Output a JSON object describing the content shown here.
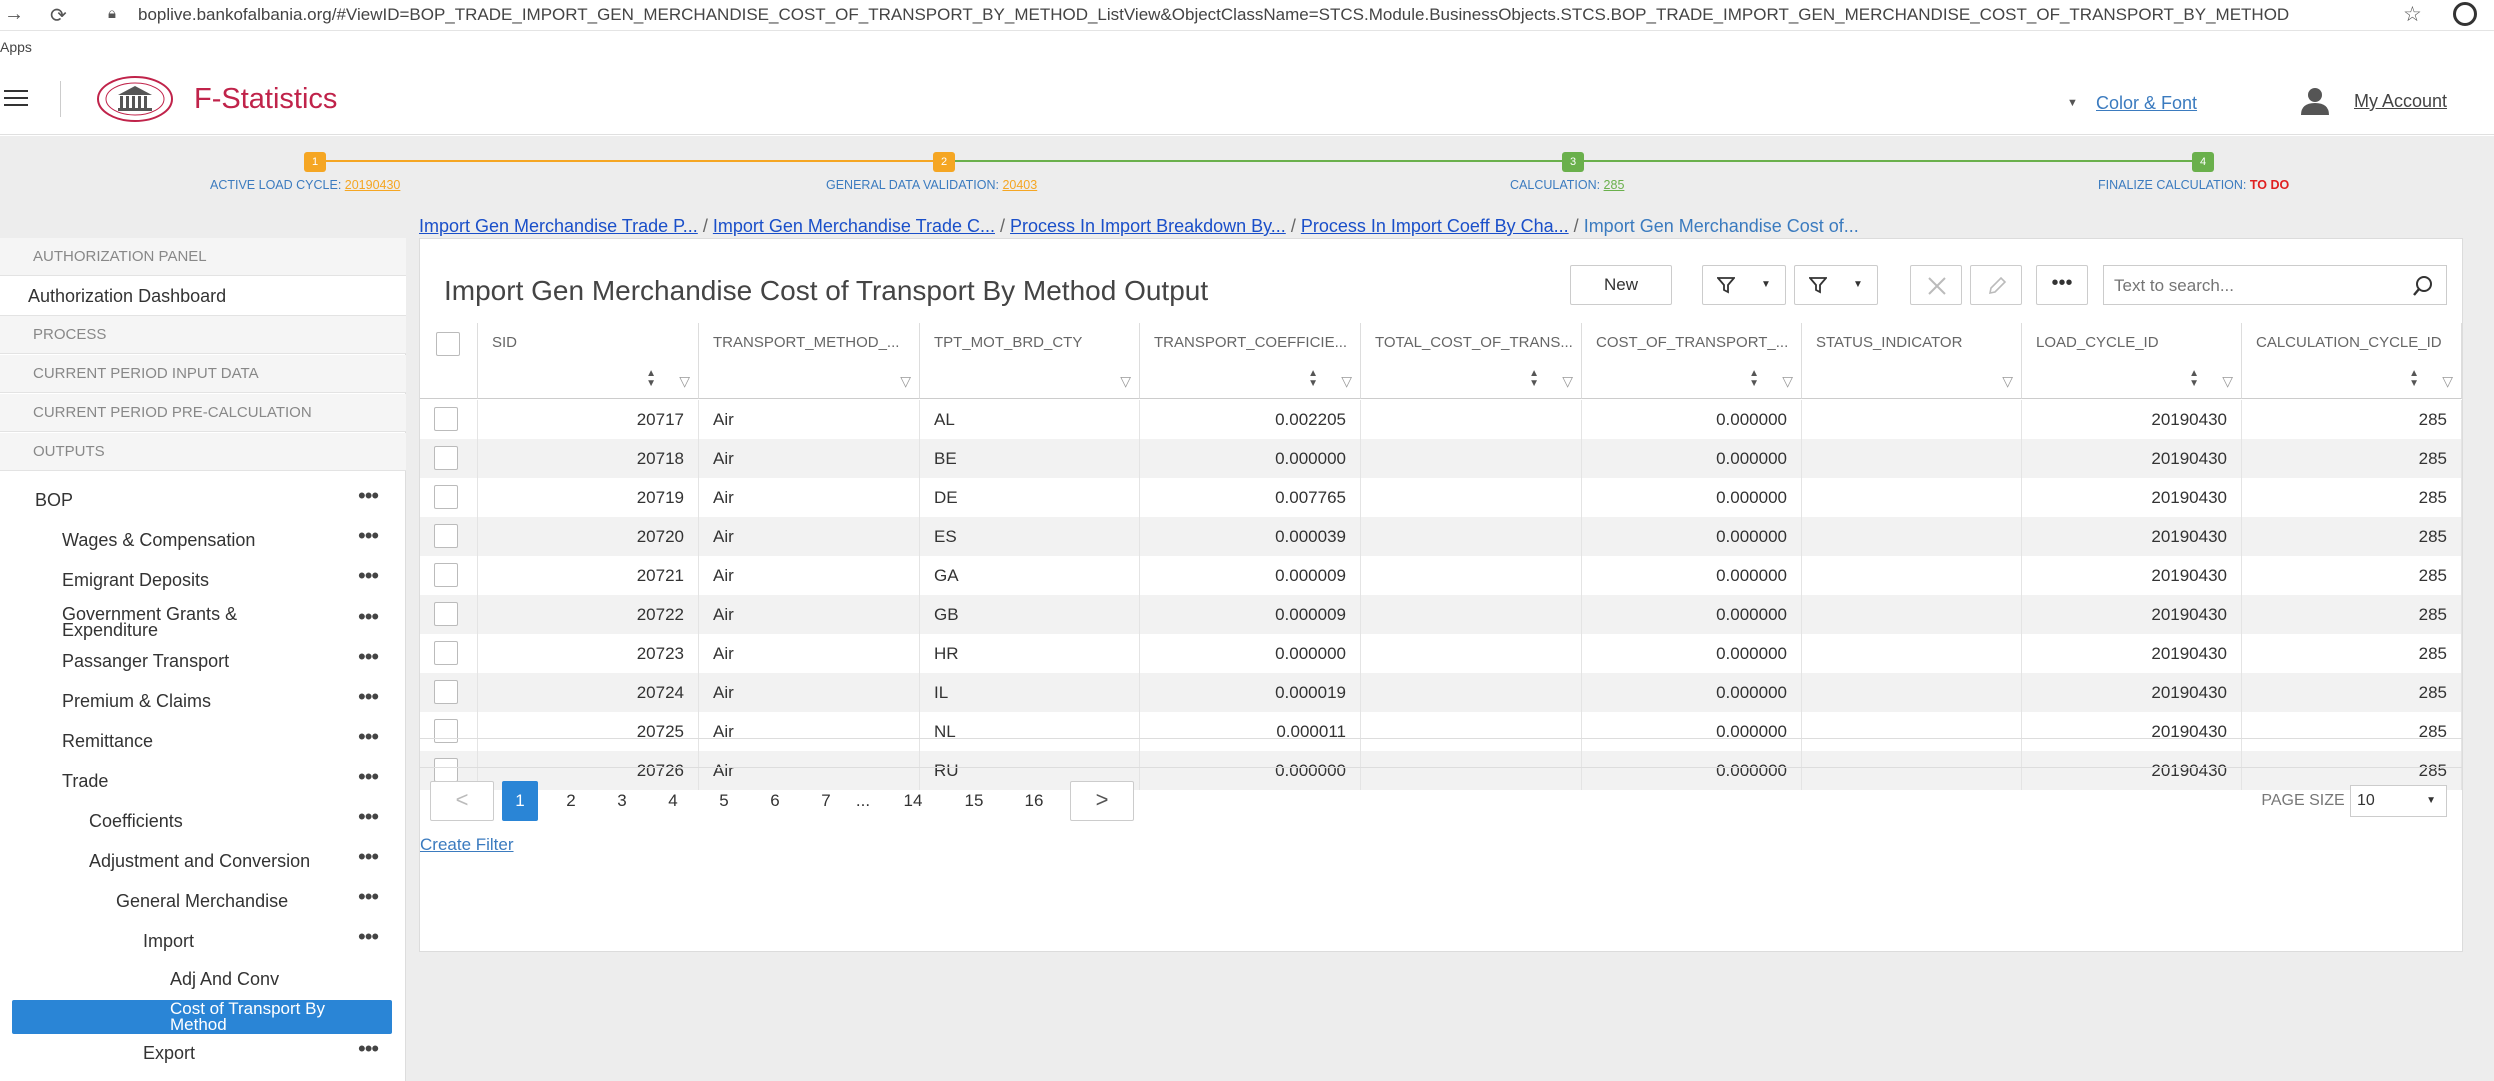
{
  "browser": {
    "url": "boplive.bankofalbania.org/#ViewID=BOP_TRADE_IMPORT_GEN_MERCHANDISE_COST_OF_TRANSPORT_BY_METHOD_ListView&ObjectClassName=STCS.Module.BusinessObjects.STCS.BOP_TRADE_IMPORT_GEN_MERCHANDISE_COST_OF_TRANSPORT_BY_METHOD",
    "apps_label": "Apps"
  },
  "header": {
    "brand": "F-Statistics",
    "color_font": "Color & Font",
    "my_account": "My Account",
    "logo_lettering": "BANK OF ALBANIA"
  },
  "progress": {
    "steps": [
      {
        "num": "1",
        "label": "ACTIVE LOAD CYCLE: ",
        "value": "20190430",
        "color": "#f5a623",
        "value_color": "#f5a623"
      },
      {
        "num": "2",
        "label": "GENERAL DATA VALIDATION: ",
        "value": "20403",
        "color": "#f5a623",
        "value_color": "#f5a623"
      },
      {
        "num": "3",
        "label": "CALCULATION: ",
        "value": "285",
        "color": "#6ab04c",
        "value_color": "#6ab04c"
      },
      {
        "num": "4",
        "label": "FINALIZE CALCULATION: ",
        "value": "TO DO",
        "color": "#6ab04c",
        "value_color": "#e02020"
      }
    ]
  },
  "sidebar": {
    "authorization_panel": "AUTHORIZATION PANEL",
    "authorization_dashboard": "Authorization Dashboard",
    "process": "PROCESS",
    "current_input": "CURRENT PERIOD INPUT DATA",
    "current_precalc": "CURRENT PERIOD PRE-CALCULATION",
    "outputs": "OUTPUTS",
    "tree": {
      "bop": "BOP",
      "wages": "Wages & Compensation",
      "emigrant": "Emigrant Deposits",
      "grants_1": "Government Grants &",
      "grants_2": "Expenditure",
      "passanger": "Passanger Transport",
      "premium": "Premium & Claims",
      "remittance": "Remittance",
      "trade": "Trade",
      "coefficients": "Coefficients",
      "adjustment": "Adjustment and Conversion",
      "general": "General Merchandise",
      "import": "Import",
      "adj_conv": "Adj And Conv",
      "cost_1": "Cost of Transport By",
      "cost_2": "Method",
      "export": "Export"
    }
  },
  "breadcrumbs": {
    "c1": "Import Gen Merchandise Trade P...",
    "c2": "Import Gen Merchandise Trade C...",
    "c3": "Process In Import Breakdown By...",
    "c4": "Process In Import Coeff By Cha...",
    "current": "Import Gen Merchandise Cost of...",
    "sep": "/"
  },
  "main": {
    "title": "Import Gen Merchandise Cost of Transport By Method Output",
    "new_button": "New",
    "search_placeholder": "Text to search...",
    "columns": [
      "SID",
      "TRANSPORT_METHOD_...",
      "TPT_MOT_BRD_CTY",
      "TRANSPORT_COEFFICIE...",
      "TOTAL_COST_OF_TRANS...",
      "COST_OF_TRANSPORT_...",
      "STATUS_INDICATOR",
      "LOAD_CYCLE_ID",
      "CALCULATION_CYCLE_ID"
    ],
    "rows": [
      [
        "20717",
        "Air",
        "AL",
        "0.002205",
        "",
        "0.000000",
        "",
        "20190430",
        "285"
      ],
      [
        "20718",
        "Air",
        "BE",
        "0.000000",
        "",
        "0.000000",
        "",
        "20190430",
        "285"
      ],
      [
        "20719",
        "Air",
        "DE",
        "0.007765",
        "",
        "0.000000",
        "",
        "20190430",
        "285"
      ],
      [
        "20720",
        "Air",
        "ES",
        "0.000039",
        "",
        "0.000000",
        "",
        "20190430",
        "285"
      ],
      [
        "20721",
        "Air",
        "GA",
        "0.000009",
        "",
        "0.000000",
        "",
        "20190430",
        "285"
      ],
      [
        "20722",
        "Air",
        "GB",
        "0.000009",
        "",
        "0.000000",
        "",
        "20190430",
        "285"
      ],
      [
        "20723",
        "Air",
        "HR",
        "0.000000",
        "",
        "0.000000",
        "",
        "20190430",
        "285"
      ],
      [
        "20724",
        "Air",
        "IL",
        "0.000019",
        "",
        "0.000000",
        "",
        "20190430",
        "285"
      ],
      [
        "20725",
        "Air",
        "NL",
        "0.000011",
        "",
        "0.000000",
        "",
        "20190430",
        "285"
      ],
      [
        "20726",
        "Air",
        "RU",
        "0.000000",
        "",
        "0.000000",
        "",
        "20190430",
        "285"
      ]
    ],
    "pages": [
      "1",
      "2",
      "3",
      "4",
      "5",
      "6",
      "7",
      "...",
      "14",
      "15",
      "16"
    ],
    "page_size_label": "PAGE SIZE",
    "page_size": "10",
    "create_filter": "Create Filter"
  }
}
